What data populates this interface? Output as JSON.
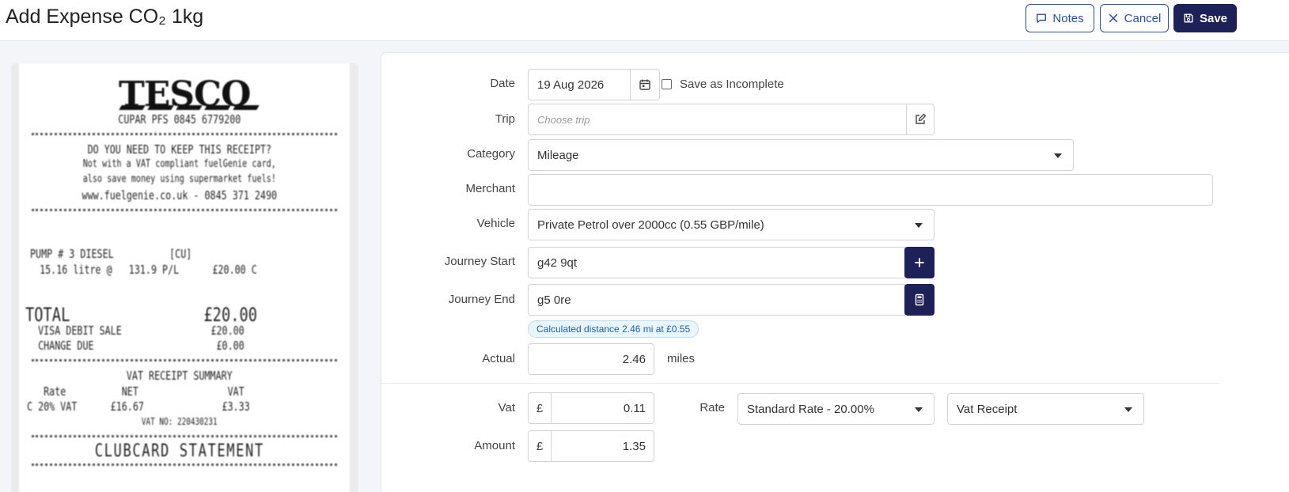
{
  "header": {
    "title": "Add Expense CO₂ 1kg",
    "notes_label": "Notes",
    "cancel_label": "Cancel",
    "save_label": "Save"
  },
  "receipt": {
    "store_name": "TESCO",
    "lines": [
      "CUPAR PFS 0845 6779200",
      "DO YOU NEED TO KEEP THIS RECEIPT?",
      "Not with a VAT compliant fuelGenie card,",
      "also save money using supermarket fuels!",
      "www.fuelgenie.co.uk - 0845 371 2490",
      "PUMP # 3 DIESEL          [CU]",
      "  15.16 litre @   131.9 P/L      £20.00 C",
      "TOTAL               £20.00",
      "  VISA DEBIT SALE                £20.00",
      "  CHANGE DUE                      £0.00",
      "VAT RECEIPT SUMMARY",
      "   Rate          NET                VAT",
      "C 20% VAT      £16.67              £3.33",
      "VAT NO: 220430231",
      "CLUBCARD STATEMENT"
    ]
  },
  "form": {
    "date": {
      "label": "Date",
      "value": "19 Aug 2026"
    },
    "save_incomplete_label": "Save as Incomplete",
    "trip": {
      "label": "Trip",
      "placeholder": "Choose trip"
    },
    "category": {
      "label": "Category",
      "value": "Mileage"
    },
    "merchant": {
      "label": "Merchant",
      "value": ""
    },
    "vehicle": {
      "label": "Vehicle",
      "value": "Private Petrol over 2000cc (0.55 GBP/mile)"
    },
    "journey_start": {
      "label": "Journey Start",
      "value": "g42 9qt"
    },
    "journey_end": {
      "label": "Journey End",
      "value": "g5 0re"
    },
    "distance_badge": "Calculated distance 2.46 mi at £0.55",
    "actual": {
      "label": "Actual",
      "value": "2.46",
      "unit": "miles"
    },
    "vat": {
      "label": "Vat",
      "currency": "£",
      "value": "0.11"
    },
    "rate": {
      "label": "Rate",
      "value": "Standard Rate - 20.00%"
    },
    "vat_receipt": {
      "value": "Vat Receipt"
    },
    "amount": {
      "label": "Amount",
      "currency": "£",
      "value": "1.35"
    }
  },
  "colors": {
    "primary": "#1e2157",
    "outline_accent": "#2b4fa6",
    "badge_bg": "#eaf6ff",
    "badge_text": "#1e5fa8"
  }
}
